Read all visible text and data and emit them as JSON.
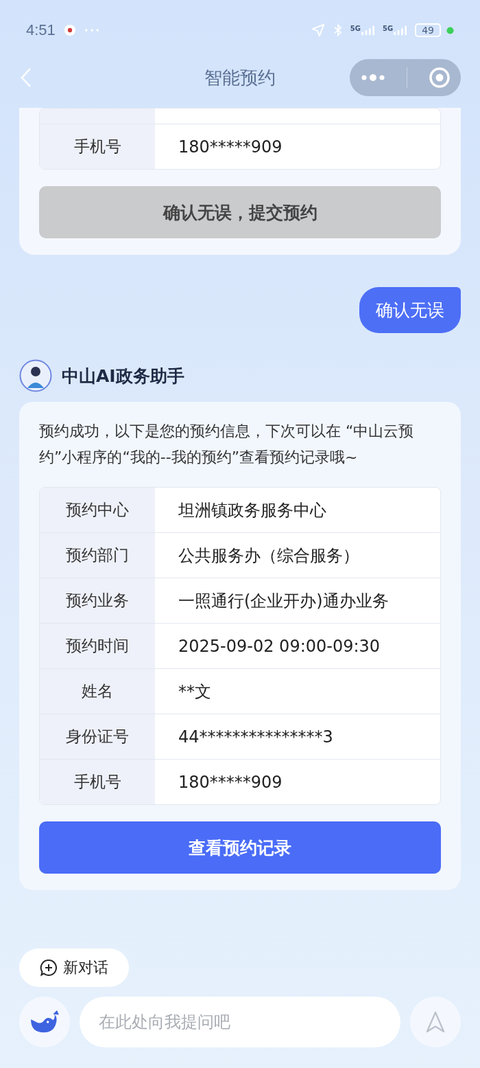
{
  "status_bar": {
    "time": "4:51",
    "networks": [
      "5G",
      "5G"
    ],
    "battery": "49"
  },
  "nav": {
    "title": "智能预约"
  },
  "previous_card": {
    "rows": [
      {
        "label": "手机号",
        "value": "180*****909"
      }
    ],
    "button": {
      "label": "确认无误，提交预约",
      "disabled": true
    }
  },
  "user_message": {
    "text": "确认无误"
  },
  "assistant": {
    "name": "中山AI政务助手",
    "text": "预约成功，以下是您的预约信息，下次可以在 “中山云预约”小程序的“我的--我的预约”查看预约记录哦~",
    "rows": [
      {
        "label": "预约中心",
        "value": "坦洲镇政务服务中心"
      },
      {
        "label": "预约部门",
        "value": "公共服务办（综合服务）"
      },
      {
        "label": "预约业务",
        "value": "一照通行(企业开办)通办业务"
      },
      {
        "label": "预约时间",
        "value": "2025-09-02 09:00-09:30"
      },
      {
        "label": "姓名",
        "value": "**文"
      },
      {
        "label": "身份证号",
        "value": "44***************3"
      },
      {
        "label": "手机号",
        "value": "180*****909"
      }
    ],
    "button": {
      "label": "查看预约记录",
      "disabled": false
    }
  },
  "new_chat": {
    "label": "新对话"
  },
  "input": {
    "placeholder": "在此处向我提问吧"
  }
}
